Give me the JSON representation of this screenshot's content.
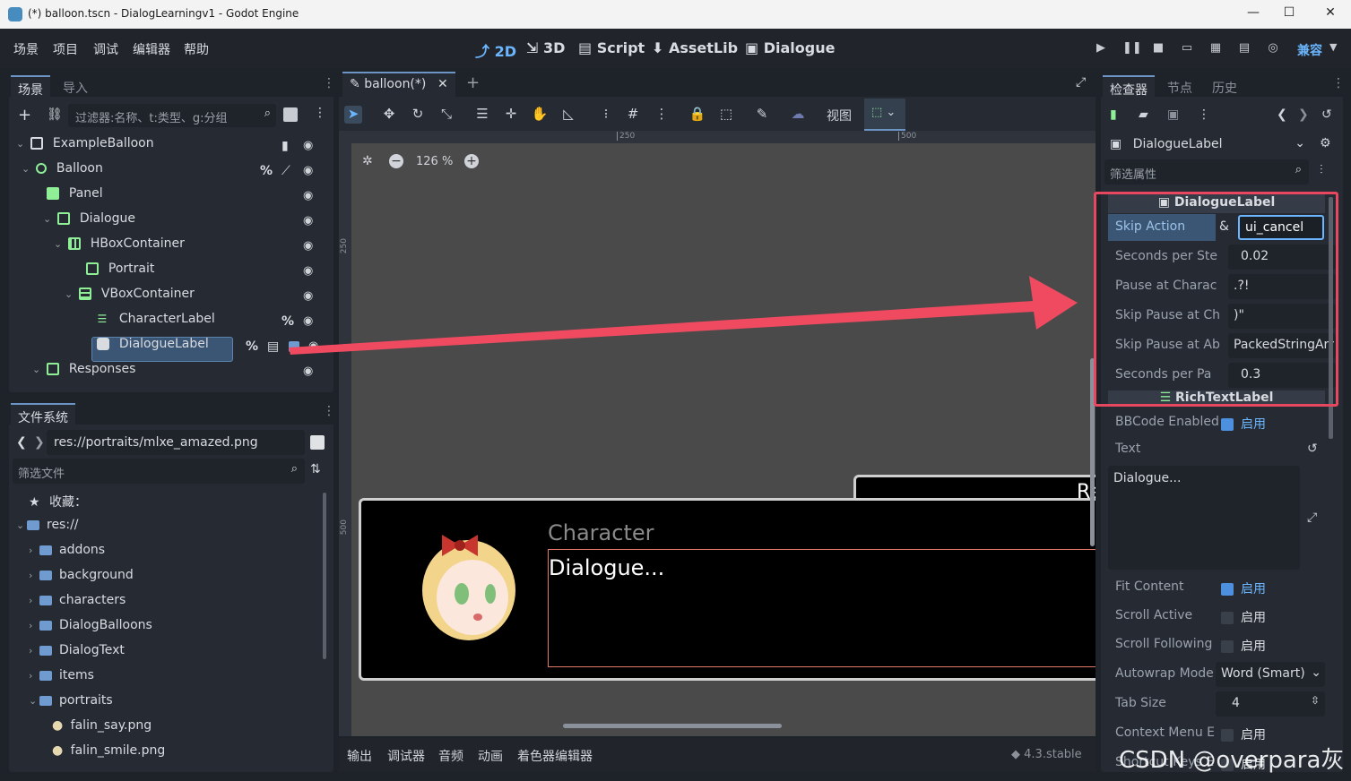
{
  "window": {
    "title": "(*) balloon.tscn - DialogLearningv1 - Godot Engine"
  },
  "menu": [
    "场景",
    "项目",
    "调试",
    "编辑器",
    "帮助"
  ],
  "modes": {
    "m2d": "2D",
    "m3d": "3D",
    "script": "Script",
    "assetlib": "AssetLib",
    "dialogue": "Dialogue"
  },
  "renderer": "兼容",
  "scene_panel": {
    "tabs": [
      "场景",
      "导入"
    ],
    "filter_placeholder": "过滤器:名称、t:类型、g:分组",
    "nodes": [
      "ExampleBalloon",
      "Balloon",
      "Panel",
      "Dialogue",
      "HBoxContainer",
      "Portrait",
      "VBoxContainer",
      "CharacterLabel",
      "DialogueLabel",
      "Responses"
    ]
  },
  "filesystem": {
    "tab": "文件系统",
    "path": "res://portraits/mlxe_amazed.png",
    "filter_placeholder": "筛选文件",
    "favorites": "收藏：",
    "root": "res://",
    "folders": [
      "addons",
      "background",
      "characters",
      "DialogBalloons",
      "DialogText",
      "items",
      "portraits"
    ],
    "files": [
      "falin_say.png",
      "falin_smile.png"
    ]
  },
  "editor": {
    "tab": "balloon(*)",
    "view_label": "视图",
    "zoom": "126 %",
    "ruler": [
      "250",
      "500"
    ],
    "vruler": [
      "250",
      "500"
    ],
    "character": "Character",
    "dialogue": "Dialogue...",
    "responses_partial": "Re"
  },
  "bottom": {
    "tabs": [
      "输出",
      "调试器",
      "音频",
      "动画",
      "着色器编辑器"
    ],
    "version": "4.3.stable"
  },
  "inspector": {
    "tabs": [
      "检查器",
      "节点",
      "历史"
    ],
    "node": "DialogueLabel",
    "filter_placeholder": "筛选属性",
    "section1": "DialogueLabel",
    "skip_action": {
      "label": "Skip Action",
      "amp": "&",
      "value": "ui_cancel"
    },
    "rows": [
      {
        "label": "Seconds per Ste",
        "value": "0.02"
      },
      {
        "label": "Pause at Charac",
        "value": ".?!"
      },
      {
        "label": "Skip Pause at Ch",
        "value": ")\""
      },
      {
        "label": "Skip Pause at Ab",
        "value": "PackedStringArr"
      },
      {
        "label": "Seconds per Pa",
        "value": "0.3"
      }
    ],
    "section2": "RichTextLabel",
    "bbcode": {
      "label": "BBCode Enabled",
      "value": "启用"
    },
    "text_label": "Text",
    "text_value": "Dialogue...",
    "bools": [
      {
        "label": "Fit Content",
        "value": "启用",
        "on": true
      },
      {
        "label": "Scroll Active",
        "value": "启用",
        "on": false
      },
      {
        "label": "Scroll Following",
        "value": "启用",
        "on": false
      }
    ],
    "autowrap": {
      "label": "Autowrap Mode",
      "value": "Word (Smart)"
    },
    "tabsize": {
      "label": "Tab Size",
      "value": "4"
    },
    "context": {
      "label": "Context Menu E",
      "value": "启用"
    },
    "shortcut": {
      "label": "Shortcut Keys E",
      "value": "启用"
    }
  },
  "watermark": "CSDN @overpara灰",
  "colors": {
    "accent": "#6cb6ff",
    "highlight": "#e8485f",
    "viewport": "#4a4a4a"
  }
}
